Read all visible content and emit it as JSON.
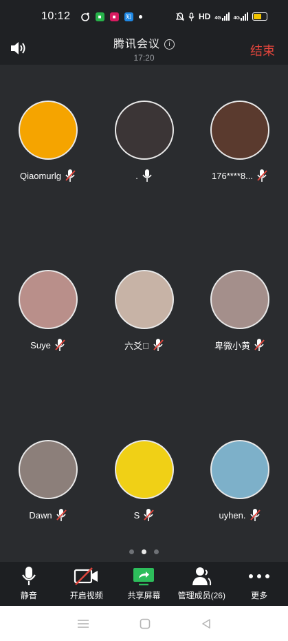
{
  "status_bar": {
    "time": "10:12",
    "network_label": "HD",
    "signal_1": "4G",
    "signal_2": "4G",
    "battery_level": 0.55
  },
  "header": {
    "title": "腾讯会议",
    "meeting_time": "17:20",
    "end_label": "结束"
  },
  "participants": [
    {
      "name": "Qiaomurlg",
      "muted": true,
      "avatar_color": "#f5a400"
    },
    {
      "name": ".",
      "muted": false,
      "avatar_color": "#3b3536"
    },
    {
      "name": "176****8...",
      "muted": true,
      "avatar_color": "#5a3a2e"
    },
    {
      "name": "Suye",
      "muted": true,
      "avatar_color": "#b98f8a"
    },
    {
      "name": "六爻\u0000",
      "muted": true,
      "avatar_color": "#c7b3a6"
    },
    {
      "name": "卑微小黄",
      "muted": true,
      "avatar_color": "#a48f8b"
    },
    {
      "name": "Dawn",
      "muted": true,
      "avatar_color": "#8c7f7a"
    },
    {
      "name": "S",
      "muted": true,
      "avatar_color": "#f0d016"
    },
    {
      "name": "uyhen.",
      "muted": true,
      "avatar_color": "#7db0c9"
    }
  ],
  "pager": {
    "pages": 3,
    "active": 2
  },
  "toolbar": {
    "mute_label": "静音",
    "video_label": "开启视频",
    "share_label": "共享屏幕",
    "members_label": "管理成员(26)",
    "more_label": "更多"
  },
  "colors": {
    "accent_red": "#e2453c",
    "share_green": "#2dbd5b"
  }
}
